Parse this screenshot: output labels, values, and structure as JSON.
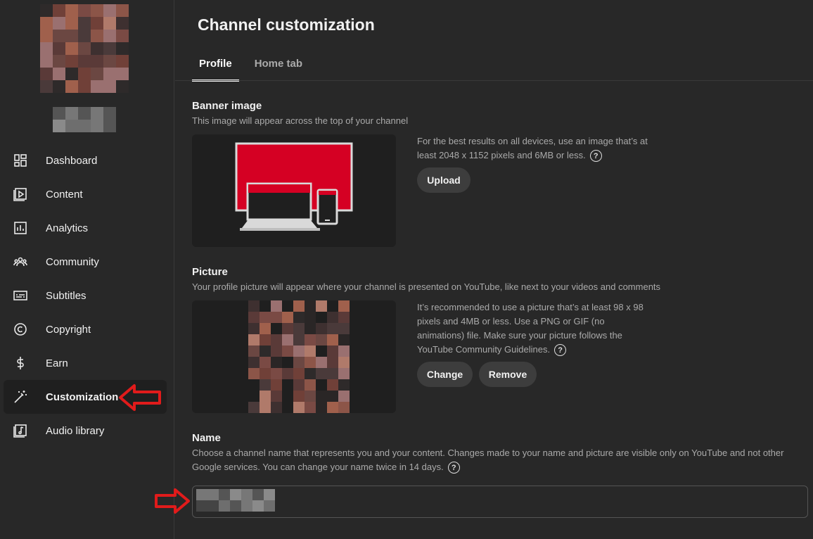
{
  "sidebar": {
    "items": [
      {
        "label": "Dashboard",
        "icon": "dashboard-icon"
      },
      {
        "label": "Content",
        "icon": "content-icon"
      },
      {
        "label": "Analytics",
        "icon": "analytics-icon"
      },
      {
        "label": "Community",
        "icon": "community-icon"
      },
      {
        "label": "Subtitles",
        "icon": "subtitles-icon"
      },
      {
        "label": "Copyright",
        "icon": "copyright-icon"
      },
      {
        "label": "Earn",
        "icon": "dollar-icon"
      },
      {
        "label": "Customization",
        "icon": "magic-wand-icon",
        "active": true
      },
      {
        "label": "Audio library",
        "icon": "audio-library-icon"
      }
    ]
  },
  "main": {
    "title": "Channel customization",
    "tabs": [
      {
        "label": "Profile",
        "active": true
      },
      {
        "label": "Home tab",
        "active": false
      }
    ],
    "banner": {
      "title": "Banner image",
      "description": "This image will appear across the top of your channel",
      "info": "For the best results on all devices, use an image that’s at least 2048 x 1152 pixels and 6MB or less.",
      "upload_label": "Upload"
    },
    "picture": {
      "title": "Picture",
      "description": "Your profile picture will appear where your channel is presented on YouTube, like next to your videos and comments",
      "info": "It’s recommended to use a picture that’s at least 98 x 98 pixels and 4MB or less. Use a PNG or GIF (no animations) file. Make sure your picture follows the YouTube Community Guidelines.",
      "change_label": "Change",
      "remove_label": "Remove"
    },
    "name": {
      "title": "Name",
      "description": "Choose a channel name that represents you and your content. Changes made to your name and picture are visible only on YouTube and not other Google services. You can change your name twice in 14 days."
    }
  },
  "colors": {
    "background": "#282828",
    "accent_red": "#d50023",
    "annotation_red": "#e11b1b"
  },
  "help_glyph": "?"
}
